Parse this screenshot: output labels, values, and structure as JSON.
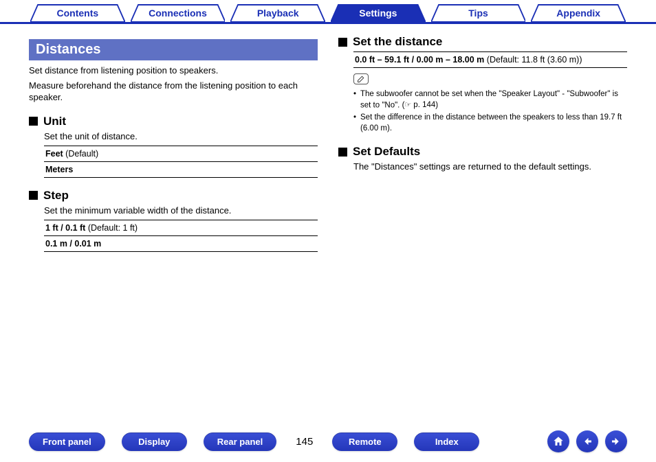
{
  "tabs": {
    "contents": "Contents",
    "connections": "Connections",
    "playback": "Playback",
    "settings": "Settings",
    "tips": "Tips",
    "appendix": "Appendix",
    "active": "settings"
  },
  "left": {
    "title": "Distances",
    "intro1": "Set distance from listening position to speakers.",
    "intro2": "Measure beforehand the distance from the listening position to each speaker.",
    "unit": {
      "heading": "Unit",
      "desc": "Set the unit of distance.",
      "opt1_bold": "Feet",
      "opt1_rest": " (Default)",
      "opt2_bold": "Meters"
    },
    "step": {
      "heading": "Step",
      "desc": "Set the minimum variable width of the distance.",
      "opt1_bold": "1 ft / 0.1 ft",
      "opt1_rest": " (Default: 1 ft)",
      "opt2_bold": "0.1 m / 0.01 m"
    }
  },
  "right": {
    "setdist": {
      "heading": "Set the distance",
      "range_bold": "0.0 ft – 59.1 ft / 0.00 m – 18.00 m",
      "range_rest": " (Default: 11.8 ft (3.60 m))",
      "note1a": "The subwoofer cannot be set when the \"Speaker Layout\" - \"Subwoofer\" is set to \"No\".  (",
      "note1_link": "p. 144",
      "note1b": ")",
      "note2": "Set the difference in the distance between the speakers to less than 19.7 ft (6.00 m)."
    },
    "setdef": {
      "heading": "Set Defaults",
      "desc": "The \"Distances\" settings are returned to the default settings."
    }
  },
  "bottom": {
    "front_panel": "Front panel",
    "display": "Display",
    "rear_panel": "Rear panel",
    "page": "145",
    "remote": "Remote",
    "index": "Index"
  }
}
